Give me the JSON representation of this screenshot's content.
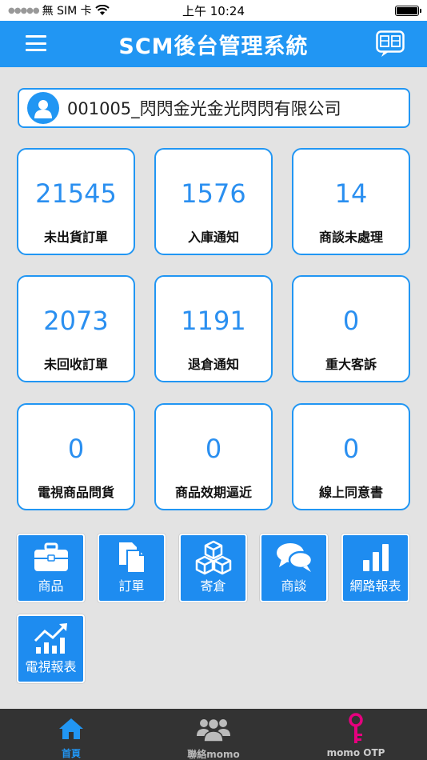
{
  "status_bar": {
    "carrier": "無 SIM 卡",
    "time": "上午 10:24"
  },
  "header": {
    "title": "SCM後台管理系統",
    "menu_icon": "hamburger-icon",
    "qa_icon": "qa-chat-icon",
    "accent": "#2196f3"
  },
  "company": {
    "name": "001005_閃閃金光金光閃閃有限公司",
    "icon": "user-avatar-icon"
  },
  "stats": [
    {
      "value": "21545",
      "label": "未出貨訂單"
    },
    {
      "value": "1576",
      "label": "入庫通知"
    },
    {
      "value": "14",
      "label": "商談未處理"
    },
    {
      "value": "2073",
      "label": "未回收訂單"
    },
    {
      "value": "1191",
      "label": "退倉通知"
    },
    {
      "value": "0",
      "label": "重大客訴"
    },
    {
      "value": "0",
      "label": "電視商品問貨"
    },
    {
      "value": "0",
      "label": "商品效期逼近"
    },
    {
      "value": "0",
      "label": "線上同意書"
    }
  ],
  "tiles": [
    {
      "label": "商品",
      "icon": "briefcase-icon"
    },
    {
      "label": "訂單",
      "icon": "documents-icon"
    },
    {
      "label": "寄倉",
      "icon": "boxes-icon"
    },
    {
      "label": "商談",
      "icon": "chat-bubbles-icon"
    },
    {
      "label": "網路報表",
      "icon": "bar-chart-icon"
    },
    {
      "label": "電視報表",
      "icon": "trend-chart-icon"
    }
  ],
  "tab_bar": {
    "tabs": [
      {
        "label": "首頁",
        "icon": "home-icon",
        "active": true,
        "color": "#2196f3"
      },
      {
        "label": "聯絡momo",
        "icon": "people-icon",
        "active": false,
        "color": "#bbbbbb"
      },
      {
        "label": "momo OTP",
        "icon": "key-icon",
        "active": false,
        "color": "#e6007e"
      }
    ]
  }
}
